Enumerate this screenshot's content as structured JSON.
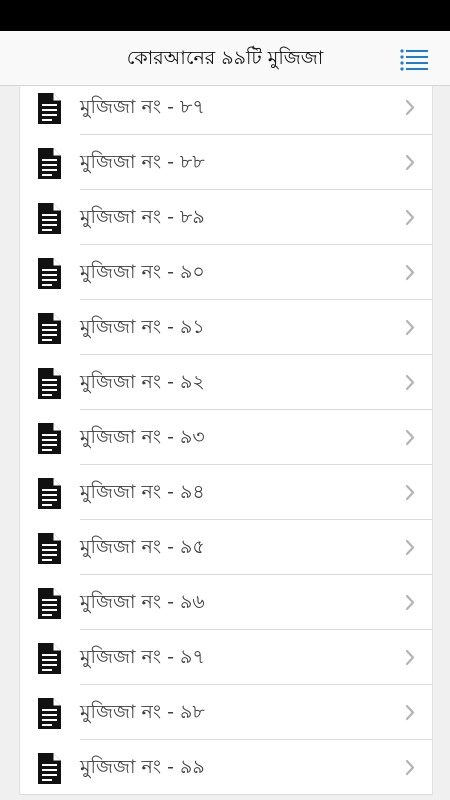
{
  "header": {
    "title": "কোরআনের ৯৯টি মুজিজা",
    "menu_icon": "list-menu-icon",
    "accent_color": "#1e7bd6"
  },
  "list": {
    "item_icon": "document-icon",
    "chevron_icon": "chevron-right-icon",
    "items": [
      {
        "label": "মুজিজা নং - ৮৭"
      },
      {
        "label": "মুজিজা নং - ৮৮"
      },
      {
        "label": "মুজিজা নং - ৮৯"
      },
      {
        "label": "মুজিজা নং - ৯০"
      },
      {
        "label": "মুজিজা নং - ৯১"
      },
      {
        "label": "মুজিজা নং - ৯২"
      },
      {
        "label": "মুজিজা নং - ৯৩"
      },
      {
        "label": "মুজিজা নং - ৯৪"
      },
      {
        "label": "মুজিজা নং - ৯৫"
      },
      {
        "label": "মুজিজা নং - ৯৬"
      },
      {
        "label": "মুজিজা নং - ৯৭"
      },
      {
        "label": "মুজিজা নং - ৯৮"
      },
      {
        "label": "মুজিজা নং - ৯৯"
      }
    ]
  }
}
